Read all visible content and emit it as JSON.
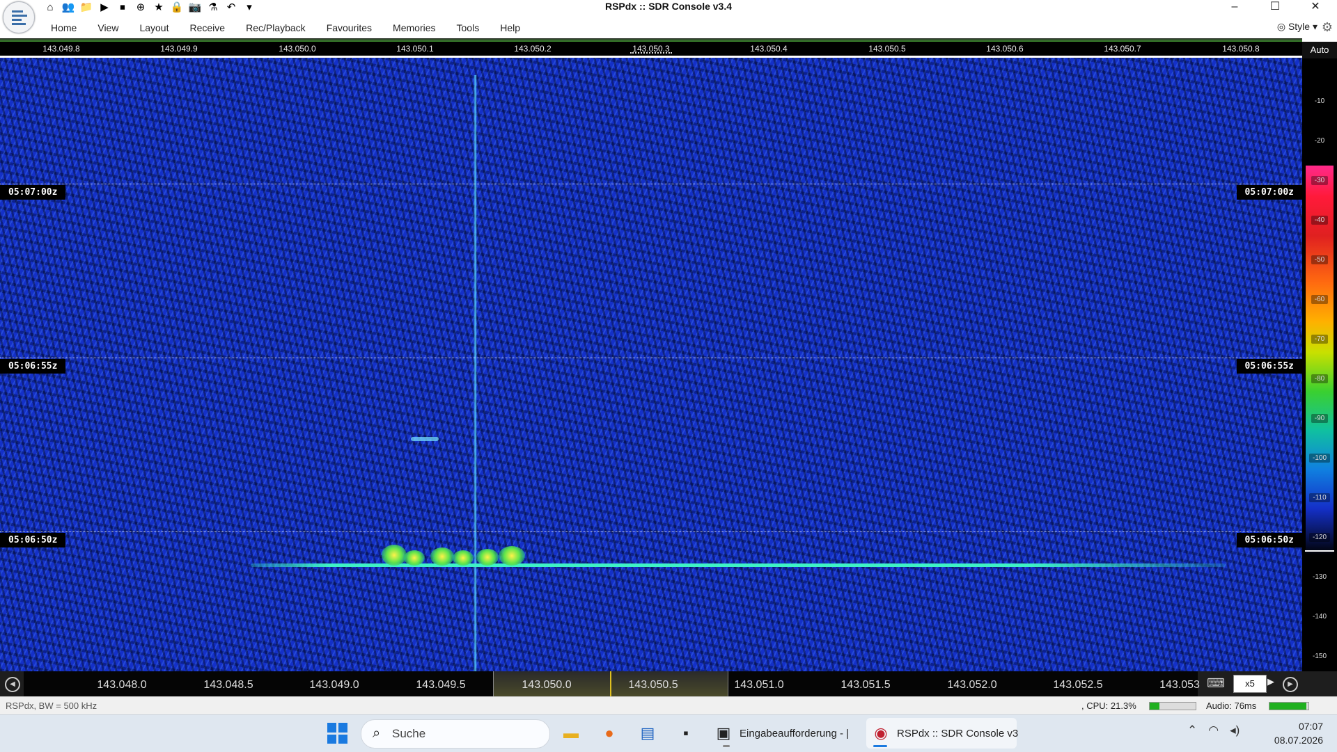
{
  "window": {
    "title": "RSPdx :: SDR Console v3.4",
    "controls": [
      "–",
      "☐",
      "✕"
    ]
  },
  "quick_access": [
    "⌂",
    "👥",
    "📁",
    "▶",
    "⏹",
    "⊕",
    "★",
    "🔒",
    "📷",
    "⚗",
    "↶",
    "▾"
  ],
  "menu": {
    "items": [
      "Home",
      "View",
      "Layout",
      "Receive",
      "Rec/Playback",
      "Favourites",
      "Memories",
      "Tools",
      "Help"
    ],
    "style_label": "Style"
  },
  "top_ruler": {
    "labels": [
      "143.049.8",
      "143.049.9",
      "143.050.0",
      "143.050.1",
      "143.050.2",
      "143.050.3",
      "143.050.4",
      "143.050.5",
      "143.050.6",
      "143.050.7",
      "143.050.8"
    ]
  },
  "waterfall": {
    "time_markers": [
      "05:07:00z",
      "05:06:55z",
      "05:06:50z"
    ]
  },
  "db_scale": {
    "auto_label": "Auto",
    "ticks": [
      "-10",
      "-20",
      "-30",
      "-40",
      "-50",
      "-60",
      "-70",
      "-80",
      "-90",
      "-100",
      "-110",
      "-120",
      "-130",
      "-140",
      "-150"
    ]
  },
  "bottom_ruler": {
    "labels": [
      "143.048.0",
      "143.048.5",
      "143.049.0",
      "143.049.5",
      "143.050.0",
      "143.050.5",
      "143.051.0",
      "143.051.5",
      "143.052.0",
      "143.052.5",
      "143.053"
    ],
    "zoom": "x5",
    "keyboard_icon": "⌨"
  },
  "status": {
    "left": "RSPdx, BW = 500 kHz",
    "cpu": ", CPU: 21.3%",
    "cpu_percent": 21.3,
    "audio": "Audio: 76ms",
    "audio_level": 0.95
  },
  "taskbar": {
    "search_placeholder": "Suche",
    "apps": [
      {
        "label": "Eingabeaufforderung - |",
        "icon": "terminal-icon"
      },
      {
        "label": "RSPdx :: SDR Console v3",
        "icon": "sdr-console-icon"
      }
    ],
    "clock_time": "07:07",
    "clock_date": "08.07.2026"
  },
  "colors": {
    "waterfall_bg": "#1430c8",
    "signal": "#3ef2c6",
    "taskbar_accent": "#1a7ae0"
  }
}
